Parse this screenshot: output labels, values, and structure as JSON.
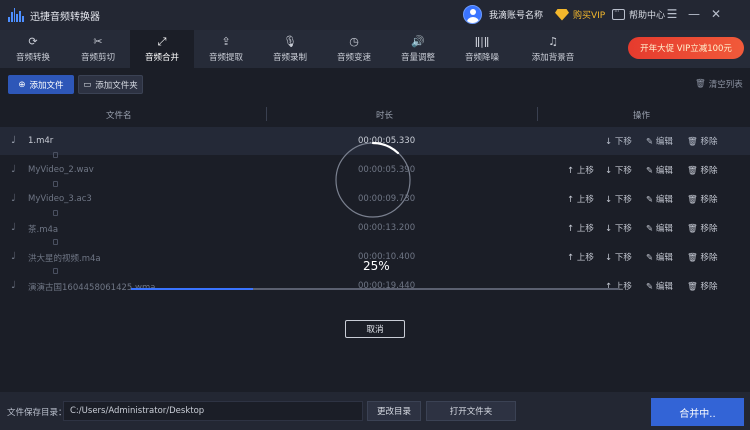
{
  "app": {
    "title": "迅捷音频转换器"
  },
  "header": {
    "username": "我滴账号名称",
    "vip_label": "购买VIP",
    "help_label": "帮助中心",
    "window_controls": [
      "☰",
      "—",
      "✕"
    ]
  },
  "nav": {
    "items": [
      {
        "label": "音频转换",
        "icon": "refresh-icon"
      },
      {
        "label": "音频剪切",
        "icon": "scissors-icon"
      },
      {
        "label": "音频合并",
        "icon": "merge-icon",
        "active": true
      },
      {
        "label": "音频提取",
        "icon": "extract-icon"
      },
      {
        "label": "音频录制",
        "icon": "microphone-icon"
      },
      {
        "label": "音频变速",
        "icon": "speed-icon"
      },
      {
        "label": "音量调整",
        "icon": "volume-icon"
      },
      {
        "label": "音频降噪",
        "icon": "noise-icon"
      },
      {
        "label": "添加背景音",
        "icon": "music-add-icon"
      }
    ],
    "promo": "开年大促 VIP立减100元"
  },
  "actions": {
    "add_file": "添加文件",
    "add_folder": "添加文件夹",
    "clear_list": "清空列表"
  },
  "table": {
    "headers": {
      "name": "文件名",
      "duration": "时长",
      "ops": "操作"
    },
    "op_labels": {
      "up": "上移",
      "down": "下移",
      "edit": "编辑",
      "remove": "移除"
    },
    "rows": [
      {
        "name": "1.m4r",
        "duration": "00:00:05.330"
      },
      {
        "name": "MyVideo_2.wav",
        "duration": "00:00:05.390"
      },
      {
        "name": "MyVideo_3.ac3",
        "duration": "00:00:09.730"
      },
      {
        "name": "茶.m4a",
        "duration": "00:00:13.200"
      },
      {
        "name": "洪大星的视频.m4a",
        "duration": "00:00:10.400"
      },
      {
        "name": "演演古国1604458061425.wma",
        "duration": "00:00:19.440"
      }
    ]
  },
  "progress": {
    "percent_text": "25%",
    "value": 0.25,
    "cancel_label": "取消"
  },
  "footer": {
    "save_dir_label": "文件保存目录：",
    "save_path": "C:/Users/Administrator/Desktop",
    "change_dir": "更改目录",
    "open_folder": "打开文件夹",
    "merge_label": "合并中.."
  },
  "colors": {
    "accent": "#3a74ff",
    "promo": "#e63b2e",
    "vip": "#f3b72c"
  }
}
